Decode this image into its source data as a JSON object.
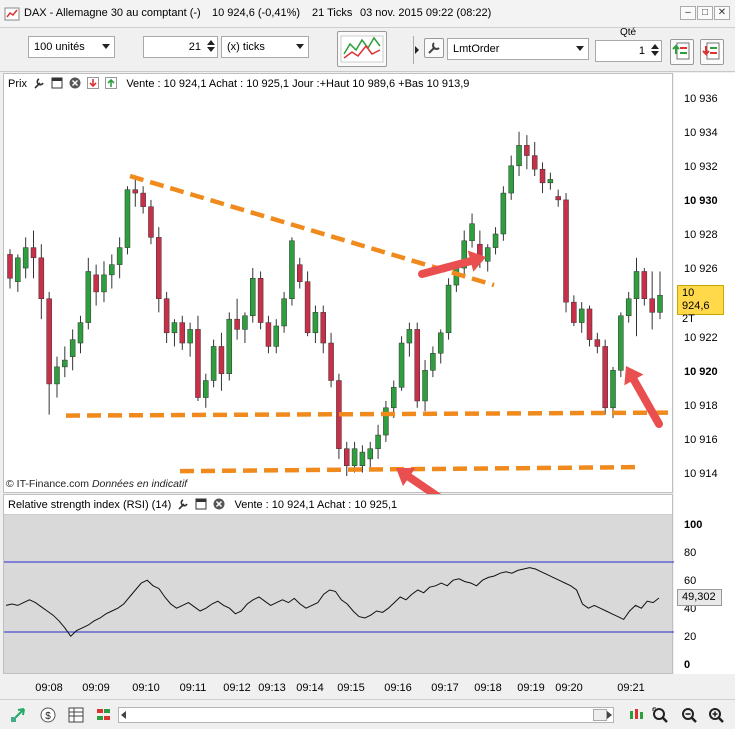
{
  "window": {
    "title": "DAX - Allemagne 30 au comptant (-)",
    "price": "10 924,6 (-0,41%)",
    "ticks": "21 Ticks",
    "datetime": "03 nov. 2015 09:22 (08:22)"
  },
  "toolbar": {
    "quantity_units": "100 unités",
    "period_value": "21",
    "period_unit": "(x) ticks",
    "order_type": "LmtOrder",
    "qty_label": "Qté",
    "qty_value": "1"
  },
  "price_panel": {
    "label": "Prix",
    "info": "Vente : 10 924,1 Achat : 10 925,1 Jour :+Haut 10 989,6 +Bas 10 913,9",
    "credit": "© IT-Finance.com",
    "credit_note": "Données en indicatif",
    "current_price": "10 924,6",
    "current_ticks": "2T"
  },
  "rsi_panel": {
    "label": "Relative strength index (RSI) (14)",
    "info": "Vente : 10 924,1 Achat : 10 925,1",
    "current_value": "49,302"
  },
  "axes": {
    "price_ticks": [
      "10 936",
      "10 934",
      "10 932",
      "10 930",
      "10 928",
      "10 926",
      "10 924",
      "10 922",
      "10 920",
      "10 918",
      "10 916",
      "10 914"
    ],
    "rsi_ticks": [
      "100",
      "80",
      "60",
      "40",
      "20",
      "0"
    ],
    "time_ticks": [
      "09:08",
      "09:09",
      "09:10",
      "09:11",
      "09:12",
      "09:13",
      "09:14",
      "09:15",
      "09:16",
      "09:17",
      "09:18",
      "09:19",
      "09:20",
      "09:21"
    ]
  },
  "colors": {
    "bull": "#2e9e3e",
    "bear": "#c8304a",
    "annotation": "#f08a1c",
    "arrow": "#e94f4f",
    "rsi_band": "#2a2ad0",
    "price_tag": "#ffd94a"
  },
  "chart_data": {
    "type": "candlestick",
    "y_unit": "price",
    "ylim": [
      10913,
      10937
    ],
    "candles": [
      {
        "o": 10927.0,
        "h": 10927.3,
        "l": 10925.0,
        "c": 10925.6
      },
      {
        "o": 10925.4,
        "h": 10927.0,
        "l": 10924.8,
        "c": 10926.8
      },
      {
        "o": 10926.2,
        "h": 10928.0,
        "l": 10925.6,
        "c": 10927.4
      },
      {
        "o": 10927.4,
        "h": 10928.4,
        "l": 10925.6,
        "c": 10926.8
      },
      {
        "o": 10926.8,
        "h": 10927.6,
        "l": 10923.2,
        "c": 10924.4
      },
      {
        "o": 10924.4,
        "h": 10924.8,
        "l": 10917.6,
        "c": 10919.4
      },
      {
        "o": 10919.4,
        "h": 10921.0,
        "l": 10918.6,
        "c": 10920.4
      },
      {
        "o": 10920.4,
        "h": 10921.6,
        "l": 10919.8,
        "c": 10920.8
      },
      {
        "o": 10921.0,
        "h": 10922.6,
        "l": 10920.2,
        "c": 10922.0
      },
      {
        "o": 10921.8,
        "h": 10923.4,
        "l": 10921.2,
        "c": 10923.0
      },
      {
        "o": 10923.0,
        "h": 10926.8,
        "l": 10922.6,
        "c": 10926.0
      },
      {
        "o": 10925.8,
        "h": 10926.4,
        "l": 10924.0,
        "c": 10924.8
      },
      {
        "o": 10924.8,
        "h": 10926.6,
        "l": 10924.2,
        "c": 10925.8
      },
      {
        "o": 10925.8,
        "h": 10927.0,
        "l": 10925.0,
        "c": 10926.4
      },
      {
        "o": 10926.4,
        "h": 10928.0,
        "l": 10925.6,
        "c": 10927.4
      },
      {
        "o": 10927.4,
        "h": 10931.0,
        "l": 10927.0,
        "c": 10930.8
      },
      {
        "o": 10930.8,
        "h": 10931.4,
        "l": 10929.8,
        "c": 10930.6
      },
      {
        "o": 10930.6,
        "h": 10931.0,
        "l": 10929.4,
        "c": 10929.8
      },
      {
        "o": 10929.8,
        "h": 10930.2,
        "l": 10927.6,
        "c": 10928.0
      },
      {
        "o": 10928.0,
        "h": 10928.6,
        "l": 10923.6,
        "c": 10924.4
      },
      {
        "o": 10924.4,
        "h": 10924.8,
        "l": 10921.8,
        "c": 10922.4
      },
      {
        "o": 10922.4,
        "h": 10923.2,
        "l": 10921.6,
        "c": 10923.0
      },
      {
        "o": 10923.0,
        "h": 10923.4,
        "l": 10921.4,
        "c": 10921.8
      },
      {
        "o": 10921.8,
        "h": 10923.0,
        "l": 10921.0,
        "c": 10922.6
      },
      {
        "o": 10922.6,
        "h": 10923.4,
        "l": 10918.4,
        "c": 10918.6
      },
      {
        "o": 10918.6,
        "h": 10920.0,
        "l": 10918.0,
        "c": 10919.6
      },
      {
        "o": 10919.6,
        "h": 10922.0,
        "l": 10919.2,
        "c": 10921.6
      },
      {
        "o": 10921.6,
        "h": 10922.4,
        "l": 10919.0,
        "c": 10920.0
      },
      {
        "o": 10920.0,
        "h": 10923.6,
        "l": 10919.6,
        "c": 10923.2
      },
      {
        "o": 10923.2,
        "h": 10924.4,
        "l": 10922.0,
        "c": 10922.6
      },
      {
        "o": 10922.6,
        "h": 10923.6,
        "l": 10921.8,
        "c": 10923.4
      },
      {
        "o": 10923.4,
        "h": 10926.2,
        "l": 10923.0,
        "c": 10925.6
      },
      {
        "o": 10925.6,
        "h": 10926.0,
        "l": 10922.6,
        "c": 10923.0
      },
      {
        "o": 10923.0,
        "h": 10923.4,
        "l": 10921.2,
        "c": 10921.6
      },
      {
        "o": 10921.6,
        "h": 10923.2,
        "l": 10921.2,
        "c": 10922.8
      },
      {
        "o": 10922.8,
        "h": 10924.8,
        "l": 10922.4,
        "c": 10924.4
      },
      {
        "o": 10924.4,
        "h": 10928.0,
        "l": 10924.0,
        "c": 10927.8
      },
      {
        "o": 10926.4,
        "h": 10926.8,
        "l": 10925.0,
        "c": 10925.4
      },
      {
        "o": 10925.4,
        "h": 10926.0,
        "l": 10922.2,
        "c": 10922.4
      },
      {
        "o": 10922.4,
        "h": 10924.0,
        "l": 10921.8,
        "c": 10923.6
      },
      {
        "o": 10923.6,
        "h": 10924.0,
        "l": 10921.2,
        "c": 10921.8
      },
      {
        "o": 10921.8,
        "h": 10922.4,
        "l": 10919.2,
        "c": 10919.6
      },
      {
        "o": 10919.6,
        "h": 10920.0,
        "l": 10915.0,
        "c": 10915.6
      },
      {
        "o": 10915.6,
        "h": 10916.0,
        "l": 10914.0,
        "c": 10914.6
      },
      {
        "o": 10914.6,
        "h": 10916.0,
        "l": 10914.2,
        "c": 10915.6
      },
      {
        "o": 10914.6,
        "h": 10915.8,
        "l": 10914.2,
        "c": 10915.4
      },
      {
        "o": 10915.0,
        "h": 10916.0,
        "l": 10914.4,
        "c": 10915.6
      },
      {
        "o": 10915.6,
        "h": 10917.0,
        "l": 10915.0,
        "c": 10916.4
      },
      {
        "o": 10916.4,
        "h": 10918.4,
        "l": 10916.0,
        "c": 10918.0
      },
      {
        "o": 10918.0,
        "h": 10919.6,
        "l": 10917.4,
        "c": 10919.2
      },
      {
        "o": 10919.2,
        "h": 10922.2,
        "l": 10919.0,
        "c": 10921.8
      },
      {
        "o": 10921.8,
        "h": 10923.0,
        "l": 10921.0,
        "c": 10922.6
      },
      {
        "o": 10922.6,
        "h": 10923.0,
        "l": 10918.0,
        "c": 10918.4
      },
      {
        "o": 10918.4,
        "h": 10920.8,
        "l": 10917.8,
        "c": 10920.2
      },
      {
        "o": 10920.2,
        "h": 10921.6,
        "l": 10919.8,
        "c": 10921.2
      },
      {
        "o": 10921.2,
        "h": 10922.6,
        "l": 10920.6,
        "c": 10922.4
      },
      {
        "o": 10922.4,
        "h": 10925.6,
        "l": 10922.0,
        "c": 10925.2
      },
      {
        "o": 10925.2,
        "h": 10926.6,
        "l": 10924.8,
        "c": 10926.2
      },
      {
        "o": 10926.2,
        "h": 10928.4,
        "l": 10925.8,
        "c": 10927.8
      },
      {
        "o": 10927.8,
        "h": 10929.4,
        "l": 10927.4,
        "c": 10928.8
      },
      {
        "o": 10927.6,
        "h": 10928.4,
        "l": 10926.2,
        "c": 10926.6
      },
      {
        "o": 10926.6,
        "h": 10927.6,
        "l": 10926.0,
        "c": 10927.4
      },
      {
        "o": 10927.4,
        "h": 10928.6,
        "l": 10927.0,
        "c": 10928.2
      },
      {
        "o": 10928.2,
        "h": 10931.0,
        "l": 10927.8,
        "c": 10930.6
      },
      {
        "o": 10930.6,
        "h": 10932.8,
        "l": 10930.2,
        "c": 10932.2
      },
      {
        "o": 10932.2,
        "h": 10934.2,
        "l": 10931.6,
        "c": 10933.4
      },
      {
        "o": 10933.4,
        "h": 10934.0,
        "l": 10932.0,
        "c": 10932.8
      },
      {
        "o": 10932.8,
        "h": 10933.6,
        "l": 10931.6,
        "c": 10932.0
      },
      {
        "o": 10932.0,
        "h": 10932.4,
        "l": 10930.6,
        "c": 10931.2
      },
      {
        "o": 10931.2,
        "h": 10931.8,
        "l": 10930.8,
        "c": 10931.4
      },
      {
        "o": 10930.4,
        "h": 10930.8,
        "l": 10929.8,
        "c": 10930.2
      },
      {
        "o": 10930.2,
        "h": 10930.6,
        "l": 10923.6,
        "c": 10924.2
      },
      {
        "o": 10924.2,
        "h": 10924.6,
        "l": 10922.8,
        "c": 10923.0
      },
      {
        "o": 10923.0,
        "h": 10924.2,
        "l": 10922.4,
        "c": 10923.8
      },
      {
        "o": 10923.8,
        "h": 10924.0,
        "l": 10921.6,
        "c": 10922.0
      },
      {
        "o": 10922.0,
        "h": 10922.4,
        "l": 10921.2,
        "c": 10921.6
      },
      {
        "o": 10921.6,
        "h": 10922.0,
        "l": 10917.6,
        "c": 10918.0
      },
      {
        "o": 10918.0,
        "h": 10920.4,
        "l": 10917.4,
        "c": 10920.2
      },
      {
        "o": 10920.2,
        "h": 10923.6,
        "l": 10919.8,
        "c": 10923.4
      },
      {
        "o": 10923.4,
        "h": 10924.8,
        "l": 10923.0,
        "c": 10924.4
      },
      {
        "o": 10924.4,
        "h": 10926.8,
        "l": 10922.2,
        "c": 10926.0
      },
      {
        "o": 10926.0,
        "h": 10926.2,
        "l": 10924.0,
        "c": 10924.4
      },
      {
        "o": 10924.4,
        "h": 10926.0,
        "l": 10922.6,
        "c": 10923.6
      },
      {
        "o": 10923.6,
        "h": 10926.0,
        "l": 10923.2,
        "c": 10924.6
      }
    ],
    "rsi": [
      44,
      45,
      44,
      46,
      48,
      46,
      43,
      40,
      37,
      33,
      28,
      22,
      26,
      28,
      30,
      33,
      35,
      38,
      40,
      42,
      45,
      50,
      55,
      60,
      62,
      58,
      56,
      50,
      45,
      42,
      44,
      46,
      43,
      40,
      42,
      45,
      47,
      44,
      42,
      38,
      40,
      45,
      48,
      50,
      47,
      44,
      46,
      48,
      46,
      49,
      45,
      42,
      44,
      46,
      52,
      55,
      54,
      48,
      45,
      40,
      36,
      35,
      37,
      40,
      39,
      42,
      46,
      50,
      48,
      52,
      55,
      53,
      57,
      58,
      60,
      58,
      62,
      63,
      61,
      60,
      58,
      62,
      64,
      65,
      67,
      68,
      67,
      69,
      70,
      71,
      70,
      68,
      66,
      64,
      62,
      60,
      58,
      55,
      45,
      42,
      44,
      42,
      40,
      38,
      36,
      34,
      40,
      44,
      42,
      47,
      46,
      49.3
    ]
  },
  "annotations": {
    "resistance_line": [
      [
        10931.6,
        0
      ],
      [
        10925.2,
        1
      ]
    ],
    "support_line_1": 10917.6,
    "support_line_2": 10914.4
  }
}
